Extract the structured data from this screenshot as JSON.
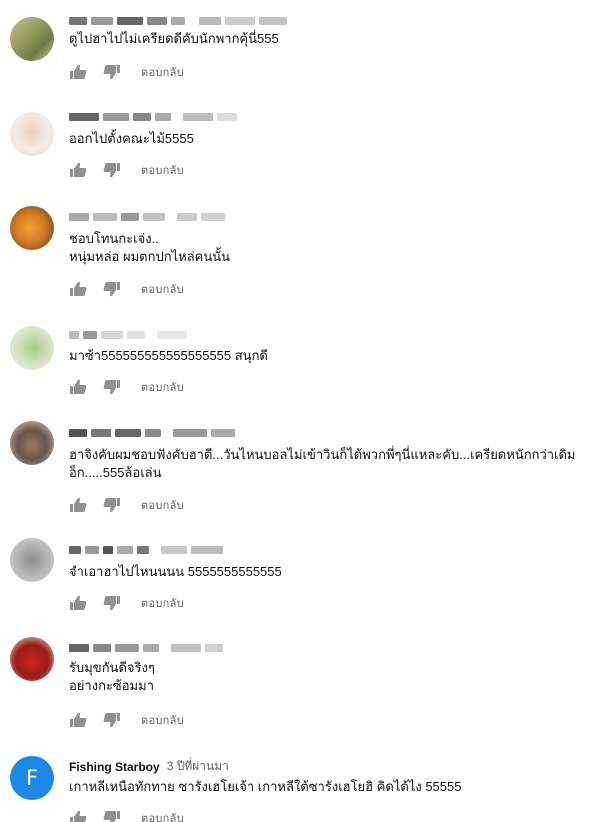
{
  "comments": [
    {
      "author": "",
      "timestamp": "",
      "lines": [
        "ดูไปฮาไปไม่เครียดดีคับนักพากคุ้นี่555"
      ],
      "reply_label": "ตอบกลับ"
    },
    {
      "author": "",
      "timestamp": "",
      "lines": [
        "ออกไปตั้งคณะไม้5555"
      ],
      "reply_label": "ตอบกลับ"
    },
    {
      "author": "",
      "timestamp": "",
      "lines": [
        "ชอบโทนกะเจ่ง..",
        "หนุ่มหล่อ ผมตกปกไหล่คนนั้น"
      ],
      "reply_label": "ตอบกลับ"
    },
    {
      "author": "",
      "timestamp": "",
      "lines": [
        "มาซ้า555555555555555555 สนุกดี"
      ],
      "reply_label": "ตอบกลับ"
    },
    {
      "author": "",
      "timestamp": "",
      "lines": [
        "ฮาจิงคับผมชอบฟังคับฮาดี...วันไหนบอลไม่เข้าวินก็ได้พวกพี่ๆนี่แหละคับ...เครียดหนักกว่าเดิม",
        "อ็ก.....555ล้อเล่น"
      ],
      "reply_label": "ตอบกลับ"
    },
    {
      "author": "",
      "timestamp": "",
      "lines": [
        "จำเอาฮาไปไหนนนน 5555555555555"
      ],
      "reply_label": "ตอบกลับ"
    },
    {
      "author": "",
      "timestamp": "",
      "lines": [
        "รับมุขกันดีจริงๆ",
        "อย่างกะซ้อมมา"
      ],
      "reply_label": "ตอบกลับ"
    },
    {
      "author": "Fishing Starboy",
      "timestamp": "3 ปีที่ผ่านมา",
      "avatar_letter": "F",
      "lines": [
        "เกาหลีเหนือทักทาย ซารังเฮโยเจ้า เกาหลีใต้ซารังเฮโยฮิ คิดได้ไง 55555"
      ],
      "reply_label": "ตอบกลับ"
    }
  ],
  "icons": {
    "like": "thumb-up-icon",
    "dislike": "thumb-down-icon"
  },
  "colors": {
    "avatar_f": "#1e88e5",
    "muted_text": "#606060",
    "icon": "#909090"
  }
}
